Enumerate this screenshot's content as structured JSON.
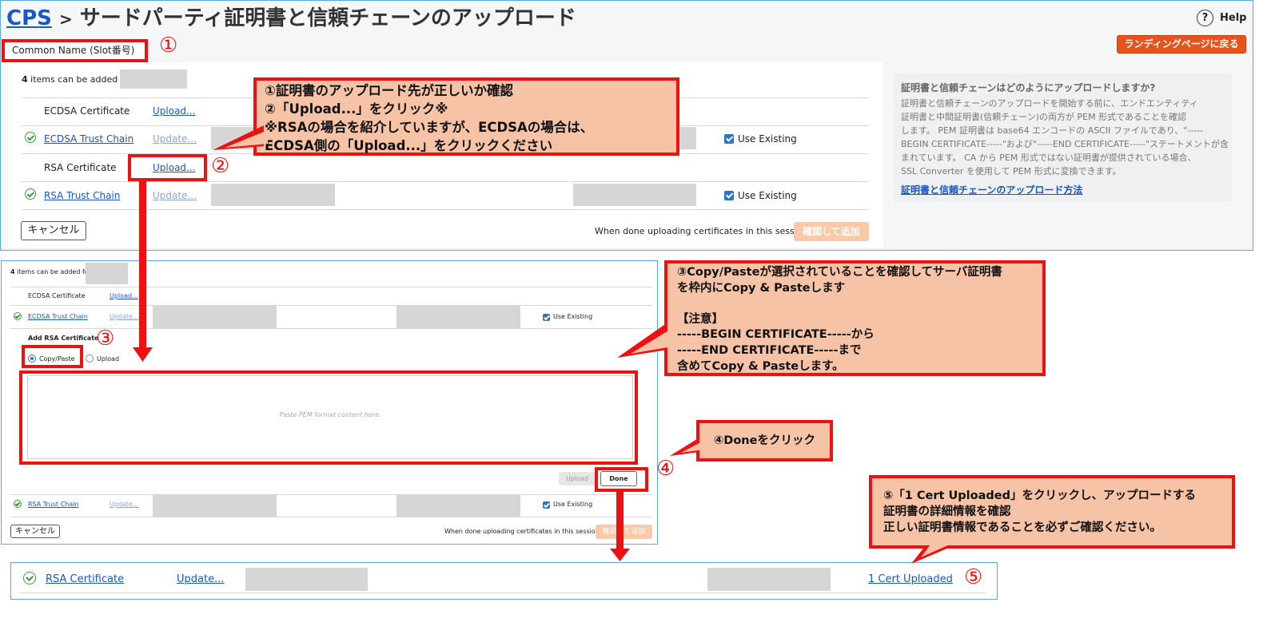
{
  "header": {
    "breadcrumb_link": "CPS",
    "breadcrumb_sep": ">",
    "title": "サードパーティ証明書と信頼チェーンのアップロード",
    "help_label": "Help",
    "landing_button": "ランディングページに戻る",
    "common_name_label": "Common Name (Slot番号)"
  },
  "top_panel": {
    "items_info": "items can be added for",
    "items_count": "4",
    "rows": [
      {
        "label": "ECDSA Certificate",
        "action": "Upload...",
        "status": "none"
      },
      {
        "label": "ECDSA Trust Chain",
        "action": "Update...",
        "status": "ok",
        "use_existing": "Use Existing"
      },
      {
        "label": "RSA Certificate",
        "action": "Upload...",
        "status": "none"
      },
      {
        "label": "RSA Trust Chain",
        "action": "Update...",
        "status": "ok",
        "use_existing": "Use Existing"
      }
    ],
    "cancel": "キャンセル",
    "done_text": "When done uploading certificates in this session:",
    "confirm_add": "確認して追加"
  },
  "help_panel": {
    "title": "証明書と信頼チェーンはどのようにアップロードしますか?",
    "lines": [
      "証明書と信頼チェーンのアップロードを開始する前に、エンドエンティティ",
      "証明書と中間証明書(信頼チェーン)の両方が PEM 形式であることを確認",
      "します。 PEM 証明書は base64 エンコードの ASCII ファイルであり、\"-----",
      "BEGIN CERTIFICATE-----\"および\"-----END CERTIFICATE-----\"ステートメントが含",
      "まれています。 CA から PEM 形式ではない証明書が提供されている場合、",
      "SSL Converter を使用して PEM 形式に変換できます。"
    ],
    "link": "証明書と信頼チェーンのアップロード方法"
  },
  "mid_panel": {
    "items_info": "items can be added for",
    "items_count": "4",
    "ecdsa_cert": "ECDSA Certificate",
    "ecdsa_cert_action": "Upload...",
    "ecdsa_chain": "ECDSA Trust Chain",
    "ecdsa_chain_action": "Update...",
    "use_existing": "Use Existing",
    "add_rsa": "Add RSA Certificate",
    "radio_copy": "Copy/Paste",
    "radio_upload": "Upload",
    "placeholder": "Paste PEM format content here.",
    "upload_btn": "Upload",
    "done_btn": "Done",
    "rsa_chain": "RSA Trust Chain",
    "rsa_chain_action": "Update...",
    "cancel": "キャンセル",
    "done_text": "When done uploading certificates in this session:",
    "confirm_add": "確認して追加"
  },
  "bottom_panel": {
    "label": "RSA Certificate",
    "action": "Update...",
    "uploaded": "1 Cert Uploaded"
  },
  "annotations": {
    "step1": "①",
    "step2": "②",
    "step3": "③",
    "step4": "④",
    "step5": "⑤",
    "callout1": [
      "①証明書のアップロード先が正しいか確認",
      "②「Upload...」をクリック※",
      "※RSAの場合を紹介していますが、ECDSAの場合は、",
      "ECDSA側の「Upload...」をクリックください"
    ],
    "callout3": [
      "③Copy/Pasteが選択されていることを確認してサーバ証明書",
      "を枠内にCopy & Pasteします",
      "",
      "【注意】",
      "-----BEGIN CERTIFICATE-----から",
      "-----END CERTIFICATE-----まで",
      "含めてCopy & Pasteします。"
    ],
    "callout4": "④Doneをクリック",
    "callout5": [
      "⑤「1 Cert Uploaded」をクリックし、アップロードする",
      "証明書の詳細情報を確認",
      "正しい証明書情報であることを必ずご確認ください。"
    ]
  },
  "colors": {
    "accent_red": "#ee1111",
    "callout_bg": "#f7c3a6",
    "link_blue": "#1a56c4",
    "panel_border": "#5aa9dc",
    "landing_orange": "#e8521c"
  }
}
